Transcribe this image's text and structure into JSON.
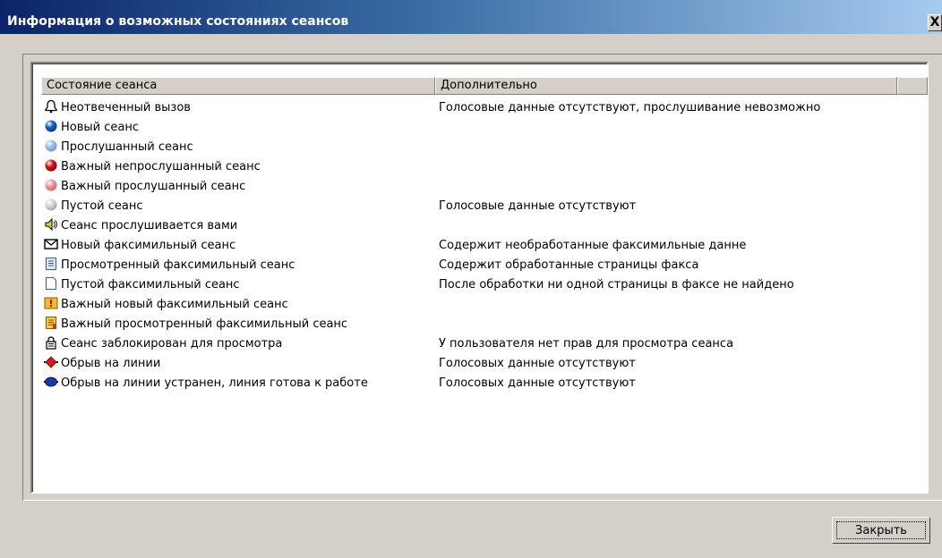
{
  "window": {
    "title": "Информация о возможных состояниях сеансов",
    "close_glyph": "X"
  },
  "table": {
    "columns": [
      "Состояние сеанса",
      "Дополнительно"
    ],
    "rows": [
      {
        "icon": "bell-icon",
        "state": "Неотвеченный вызов",
        "extra": "Голосовые данные отсутствуют, прослушивание невозможно"
      },
      {
        "icon": "blue-ball-icon",
        "state": "Новый сеанс",
        "extra": ""
      },
      {
        "icon": "light-blue-ball-icon",
        "state": "Прослушанный сеанс",
        "extra": ""
      },
      {
        "icon": "red-ball-icon",
        "state": "Важный непрослушанный сеанс",
        "extra": ""
      },
      {
        "icon": "pink-ball-icon",
        "state": "Важный прослушанный сеанс",
        "extra": ""
      },
      {
        "icon": "gray-ball-icon",
        "state": "Пустой сеанс",
        "extra": "Голосовые данные отсутствуют"
      },
      {
        "icon": "speaker-icon",
        "state": "Сеанс прослушивается вами",
        "extra": ""
      },
      {
        "icon": "envelope-icon",
        "state": "Новый факсимильный сеанс",
        "extra": "Содержит необработанные факсимильные данне"
      },
      {
        "icon": "document-icon",
        "state": "Просмотренный факсимильный сеанс",
        "extra": "Содержит обработанные страницы факса"
      },
      {
        "icon": "empty-document-icon",
        "state": "Пустой факсимильный сеанс",
        "extra": "После обработки ни одной страницы в факсе не найдено"
      },
      {
        "icon": "important-fax-icon",
        "state": "Важный новый факсимильный сеанс",
        "extra": ""
      },
      {
        "icon": "important-viewed-fax-icon",
        "state": "Важный просмотренный факсимильный сеанс",
        "extra": ""
      },
      {
        "icon": "lock-icon",
        "state": "Сеанс заблокирован для просмотра",
        "extra": "У пользователя нет прав для просмотра сеанса"
      },
      {
        "icon": "line-break-red-icon",
        "state": "Обрыв на линии",
        "extra": "Голосовых данные отсутствуют"
      },
      {
        "icon": "line-restored-blue-icon",
        "state": "Обрыв на линии устранен, линия готова к работе",
        "extra": "Голосовых данные отсутствуют"
      }
    ]
  },
  "buttons": {
    "close_label": "Закрыть"
  }
}
